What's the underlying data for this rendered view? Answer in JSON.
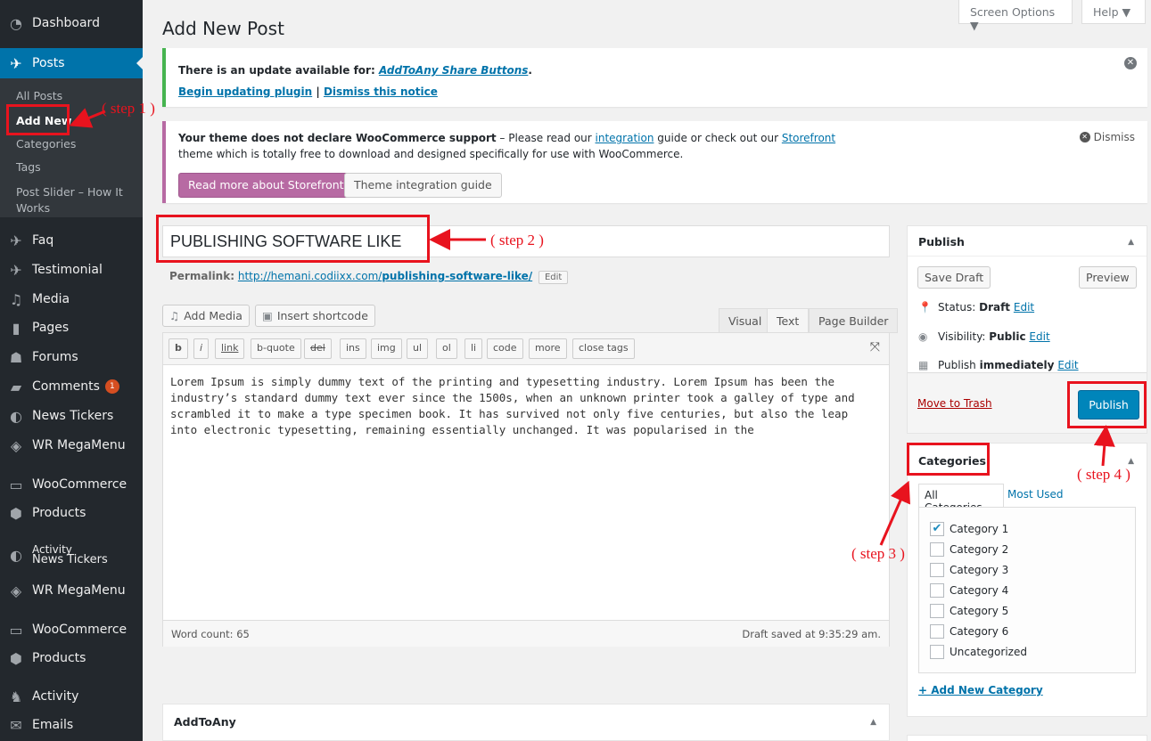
{
  "sidebar": {
    "dashboard": "Dashboard",
    "posts": "Posts",
    "submenu": [
      "All Posts",
      "Add New",
      "Categories",
      "Tags",
      "Post Slider – How It",
      "Works"
    ],
    "items": [
      "Faq",
      "Testimonial",
      "Media",
      "Pages",
      "Forums",
      "Comments",
      "News Tickers",
      "WR MegaMenu",
      "WooCommerce",
      "Products"
    ],
    "comments_badge": "1",
    "activity_overlap": "Activity",
    "news_tickers_2": "News Tickers",
    "items_lower": [
      "WR MegaMenu",
      "WooCommerce",
      "Products",
      "Activity",
      "Emails"
    ]
  },
  "header": {
    "screen_options": "Screen Options ▼",
    "help": "Help ▼",
    "title": "Add New Post"
  },
  "notice_update": {
    "text_prefix": "There is an update available for: ",
    "plugin": "AddToAny Share Buttons",
    "text_suffix": ".",
    "begin_link": "Begin updating plugin",
    "separator": " | ",
    "dismiss_link": "Dismiss this notice"
  },
  "notice_woo": {
    "bold": "Your theme does not declare WooCommerce support",
    "text1": " – Please read our ",
    "link1": "integration",
    "text2": " guide or check out our ",
    "link2": "Storefront",
    "line2": "theme which is totally free to download and designed specifically for use with WooCommerce.",
    "dismiss": "Dismiss",
    "btn_primary": "Read more about Storefront",
    "btn_secondary": "Theme integration guide"
  },
  "post": {
    "title": "PUBLISHING SOFTWARE LIKE",
    "permalink_label": "Permalink:",
    "permalink_prefix": "http://hemani.codiixx.com/",
    "permalink_slug": "publishing-software-like/",
    "edit": "Edit"
  },
  "editor": {
    "add_media": "Add Media",
    "insert_shortcode": "Insert shortcode",
    "tabs": [
      "Visual",
      "Text",
      "Page Builder"
    ],
    "quicktags": [
      "b",
      "i",
      "link",
      "b-quote",
      "del",
      "ins",
      "img",
      "ul",
      "ol",
      "li",
      "code",
      "more",
      "close tags"
    ],
    "content": "Lorem Ipsum is simply dummy text of the printing and typesetting industry. Lorem Ipsum has been the\nindustry’s standard dummy text ever since the 1500s, when an unknown printer took a galley of type and\nscrambled it to make a type specimen book. It has survived not only five centuries, but also the leap\ninto electronic typesetting, remaining essentially unchanged. It was popularised in the",
    "word_count": "Word count: 65",
    "draft_saved": "Draft saved at 9:35:29 am."
  },
  "addtoany": {
    "title": "AddToAny"
  },
  "publish": {
    "title": "Publish",
    "save_draft": "Save Draft",
    "preview": "Preview",
    "status_label": "Status: ",
    "status_value": "Draft",
    "visibility_label": "Visibility: ",
    "visibility_value": "Public",
    "publish_label": "Publish ",
    "publish_value": "immediately",
    "edit": "Edit",
    "trash": "Move to Trash",
    "publish_btn": "Publish"
  },
  "categories": {
    "title": "Categories",
    "tab_all": "All Categories",
    "tab_used": "Most Used",
    "items": [
      {
        "label": "Category 1",
        "checked": true
      },
      {
        "label": "Category 2",
        "checked": false
      },
      {
        "label": "Category 3",
        "checked": false
      },
      {
        "label": "Category 4",
        "checked": false
      },
      {
        "label": "Category 5",
        "checked": false
      },
      {
        "label": "Category 6",
        "checked": false
      },
      {
        "label": "Uncategorized",
        "checked": false
      }
    ],
    "add_new": "+ Add New Category"
  },
  "annotations": {
    "step1": "( step 1 )",
    "step2": "( step 2 )",
    "step3": "( step 3 )",
    "step4": "( step 4 )"
  },
  "colors": {
    "sidebar": "#23282d",
    "accent": "#0073aa",
    "woo": "#b76aa3",
    "annotation": "#e8131e"
  }
}
